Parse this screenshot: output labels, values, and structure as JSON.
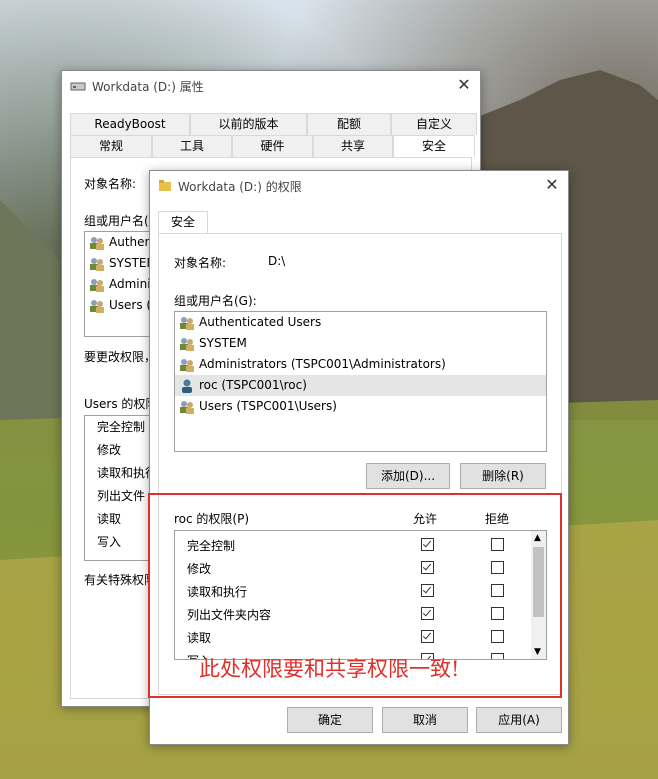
{
  "back_window": {
    "title": "Workdata (D:) 属性",
    "tabs_row1": [
      "ReadyBoost",
      "以前的版本",
      "配额",
      "自定义"
    ],
    "tabs_row2": [
      "常规",
      "工具",
      "硬件",
      "共享",
      "安全"
    ],
    "object_name_label": "对象名称:",
    "group_label": "组或用户名(G):",
    "users": [
      "Authent",
      "SYSTEM",
      "Adminis",
      "Users ("
    ],
    "change_hint": "要更改权限，",
    "perm_for": "Users 的权限",
    "perms": [
      "完全控制",
      "修改",
      "读取和执行",
      "列出文件",
      "读取",
      "写入"
    ],
    "special_hint": "有关特殊权限"
  },
  "front_window": {
    "title": "Workdata (D:) 的权限",
    "tab": "安全",
    "object_name_label": "对象名称:",
    "object_name_value": "D:\\",
    "group_label": "组或用户名(G):",
    "users": [
      {
        "name": "Authenticated Users",
        "icon": "user-group-icon",
        "selected": false
      },
      {
        "name": "SYSTEM",
        "icon": "user-group-icon",
        "selected": false
      },
      {
        "name": "Administrators (TSPC001\\Administrators)",
        "icon": "user-group-icon",
        "selected": false
      },
      {
        "name": "roc (TSPC001\\roc)",
        "icon": "user-icon",
        "selected": true
      },
      {
        "name": "Users (TSPC001\\Users)",
        "icon": "user-group-icon",
        "selected": false
      }
    ],
    "add_button": "添加(D)...",
    "remove_button": "删除(R)",
    "perm_for": "roc 的权限(P)",
    "allow_header": "允许",
    "deny_header": "拒绝",
    "permissions": [
      {
        "name": "完全控制",
        "allow": true,
        "deny": false
      },
      {
        "name": "修改",
        "allow": true,
        "deny": false
      },
      {
        "name": "读取和执行",
        "allow": true,
        "deny": false
      },
      {
        "name": "列出文件夹内容",
        "allow": true,
        "deny": false
      },
      {
        "name": "读取",
        "allow": true,
        "deny": false
      },
      {
        "name": "写入",
        "allow": true,
        "deny": false
      }
    ],
    "ok_button": "确定",
    "cancel_button": "取消",
    "apply_button": "应用(A)"
  },
  "annotation": {
    "text": "此处权限要和共享权限一致!",
    "color": "#e0302a"
  }
}
